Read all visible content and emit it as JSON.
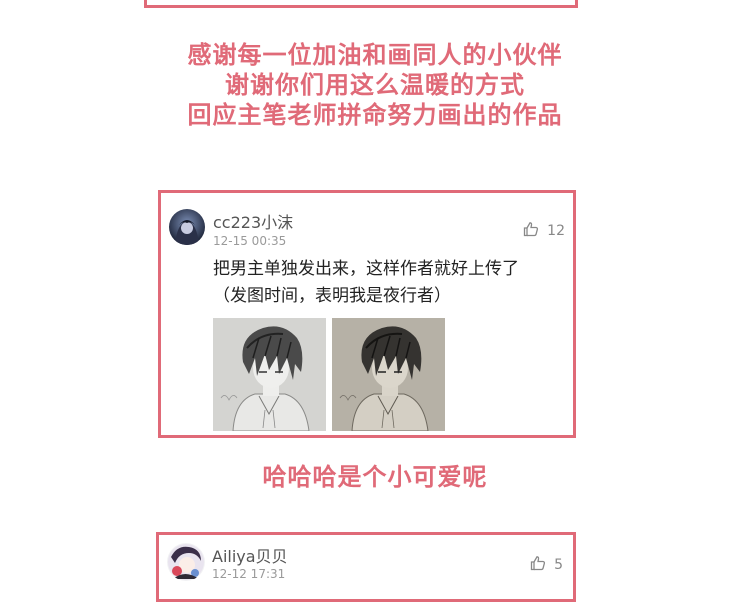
{
  "headline1": {
    "lines": [
      "感谢每一位加油和画同人的小伙伴",
      "谢谢你们用这么温暖的方式",
      "回应主笔老师拼命努力画出的作品"
    ]
  },
  "comment1": {
    "username": "cc223小沫",
    "time": "12-15 00:35",
    "likes": "12",
    "text_lines": [
      "把男主单独发出来，这样作者就好上传了",
      "（发图时间，表明我是夜行者）"
    ]
  },
  "headline2": "哈哈哈是个小可爱呢",
  "comment2": {
    "username": "Ailiya贝贝",
    "time": "12-12 17:31",
    "likes": "5"
  },
  "colors": {
    "accent": "#e06a78",
    "username": "#555555",
    "meta": "#9a9a9a"
  },
  "icons": {
    "like": "thumbs-up-icon"
  }
}
